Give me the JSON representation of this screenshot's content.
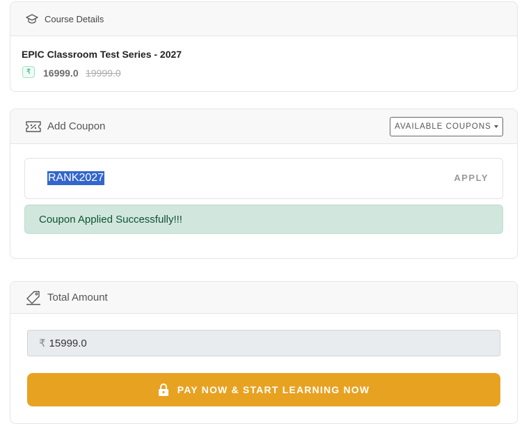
{
  "course_card": {
    "title": "Course Details",
    "course_name": "EPIC Classroom Test Series - 2027",
    "currency_symbol": "₹",
    "price": "16999.0",
    "original_price": "19999.0"
  },
  "coupon_card": {
    "title": "Add Coupon",
    "available_coupons_label": "AVAILABLE COUPONS",
    "coupon_value": "RANK2027",
    "apply_label": "APPLY",
    "success_message": "Coupon Applied Successfully!!!"
  },
  "total_card": {
    "title": "Total Amount",
    "currency_symbol": "₹",
    "amount": "15999.0",
    "pay_label": "PAY NOW & START LEARNING NOW"
  },
  "colors": {
    "pay_button": "#e8a221",
    "success_bg": "#d1e7dd",
    "success_text": "#0f5132",
    "selection": "#3366cc"
  },
  "icons": {
    "course": "graduation-cap-icon",
    "coupon": "ticket-percent-icon",
    "total": "tag-icon",
    "pay": "lock-icon"
  }
}
